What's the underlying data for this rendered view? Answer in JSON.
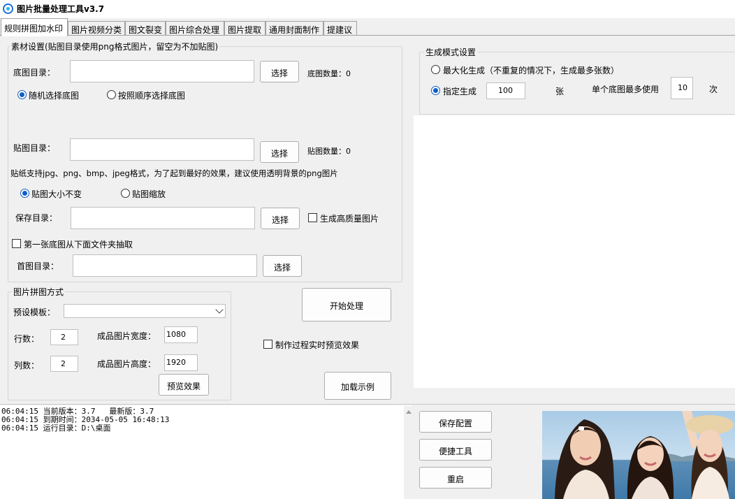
{
  "app": {
    "title": "图片批量处理工具v3.7"
  },
  "tabs": [
    {
      "label": "规则拼图加水印",
      "active": true
    },
    {
      "label": "图片视频分类",
      "active": false
    },
    {
      "label": "图文裂变",
      "active": false
    },
    {
      "label": "图片综合处理",
      "active": false
    },
    {
      "label": "图片提取",
      "active": false
    },
    {
      "label": "通用封面制作",
      "active": false
    },
    {
      "label": "提建议",
      "active": false
    }
  ],
  "material": {
    "title": "素材设置(贴图目录使用png格式图片，留空为不加贴图)",
    "base_dir": {
      "label": "底图目录：",
      "value": "",
      "button": "选择",
      "count_label": "底图数量：0"
    },
    "base_order": {
      "random_label": "随机选择底图",
      "sequential_label": "按照顺序选择底图",
      "selected": "random"
    },
    "sticker_dir": {
      "label": "贴图目录：",
      "value": "",
      "button": "选择",
      "count_label": "贴图数量：0"
    },
    "sticker_hint": "贴纸支持jpg、png、bmp、jpeg格式，为了起到最好的效果，建议使用透明背景的png图片",
    "sticker_size": {
      "keep_label": "贴图大小不变",
      "scale_label": "贴图缩放",
      "selected": "keep"
    },
    "save_dir": {
      "label": "保存目录：",
      "value": "",
      "button": "选择",
      "hq_label": "生成高质量图片",
      "hq_checked": false
    },
    "first_from_folder": {
      "label": "第一张底图从下面文件夹抽取",
      "checked": false
    },
    "first_dir": {
      "label": "首图目录：",
      "value": "",
      "button": "选择"
    }
  },
  "mosaic": {
    "title": "图片拼图方式",
    "preset": {
      "label": "预设模板：",
      "value": ""
    },
    "rows": {
      "label": "行数：",
      "value": "2"
    },
    "cols": {
      "label": "列数：",
      "value": "2"
    },
    "width": {
      "label": "成品图片宽度：",
      "value": "1080"
    },
    "height": {
      "label": "成品图片高度：",
      "value": "1920"
    },
    "preview_button": "预览效果"
  },
  "actions": {
    "start_button": "开始处理",
    "realtime_preview": {
      "label": "制作过程实时预览效果",
      "checked": false
    },
    "load_example_button": "加载示例"
  },
  "gen_mode": {
    "title": "生成模式设置",
    "max_label": "最大化生成（不重复的情况下，生成最多张数）",
    "specified_label": "指定生成",
    "selected": "specified",
    "count_value": "100",
    "count_unit": "张",
    "max_use_label": "单个底图最多使用",
    "max_use_value": "10",
    "max_use_unit": "次"
  },
  "log": {
    "lines": [
      "06:04:15 当前版本：3.7   最新版：3.7",
      "06:04:15 到期时间：2034-05-05 16:48:13",
      "06:04:15 运行目录：D:\\桌面"
    ]
  },
  "side_buttons": {
    "save_config": "保存配置",
    "shortcut_tools": "便捷工具",
    "restart": "重启"
  }
}
